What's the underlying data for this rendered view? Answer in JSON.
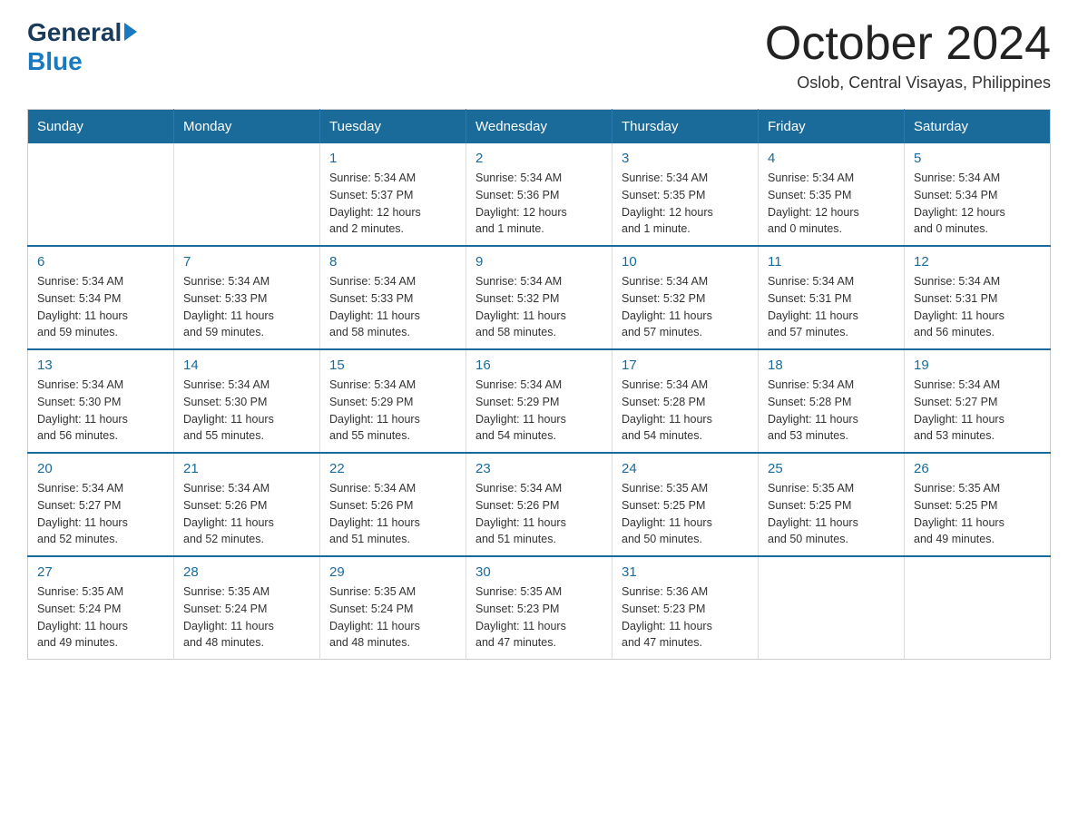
{
  "header": {
    "logo": {
      "general": "General",
      "arrow": "▶",
      "blue": "Blue"
    },
    "title": "October 2024",
    "location": "Oslob, Central Visayas, Philippines"
  },
  "calendar": {
    "days_of_week": [
      "Sunday",
      "Monday",
      "Tuesday",
      "Wednesday",
      "Thursday",
      "Friday",
      "Saturday"
    ],
    "weeks": [
      [
        {
          "day": "",
          "info": ""
        },
        {
          "day": "",
          "info": ""
        },
        {
          "day": "1",
          "info": "Sunrise: 5:34 AM\nSunset: 5:37 PM\nDaylight: 12 hours\nand 2 minutes."
        },
        {
          "day": "2",
          "info": "Sunrise: 5:34 AM\nSunset: 5:36 PM\nDaylight: 12 hours\nand 1 minute."
        },
        {
          "day": "3",
          "info": "Sunrise: 5:34 AM\nSunset: 5:35 PM\nDaylight: 12 hours\nand 1 minute."
        },
        {
          "day": "4",
          "info": "Sunrise: 5:34 AM\nSunset: 5:35 PM\nDaylight: 12 hours\nand 0 minutes."
        },
        {
          "day": "5",
          "info": "Sunrise: 5:34 AM\nSunset: 5:34 PM\nDaylight: 12 hours\nand 0 minutes."
        }
      ],
      [
        {
          "day": "6",
          "info": "Sunrise: 5:34 AM\nSunset: 5:34 PM\nDaylight: 11 hours\nand 59 minutes."
        },
        {
          "day": "7",
          "info": "Sunrise: 5:34 AM\nSunset: 5:33 PM\nDaylight: 11 hours\nand 59 minutes."
        },
        {
          "day": "8",
          "info": "Sunrise: 5:34 AM\nSunset: 5:33 PM\nDaylight: 11 hours\nand 58 minutes."
        },
        {
          "day": "9",
          "info": "Sunrise: 5:34 AM\nSunset: 5:32 PM\nDaylight: 11 hours\nand 58 minutes."
        },
        {
          "day": "10",
          "info": "Sunrise: 5:34 AM\nSunset: 5:32 PM\nDaylight: 11 hours\nand 57 minutes."
        },
        {
          "day": "11",
          "info": "Sunrise: 5:34 AM\nSunset: 5:31 PM\nDaylight: 11 hours\nand 57 minutes."
        },
        {
          "day": "12",
          "info": "Sunrise: 5:34 AM\nSunset: 5:31 PM\nDaylight: 11 hours\nand 56 minutes."
        }
      ],
      [
        {
          "day": "13",
          "info": "Sunrise: 5:34 AM\nSunset: 5:30 PM\nDaylight: 11 hours\nand 56 minutes."
        },
        {
          "day": "14",
          "info": "Sunrise: 5:34 AM\nSunset: 5:30 PM\nDaylight: 11 hours\nand 55 minutes."
        },
        {
          "day": "15",
          "info": "Sunrise: 5:34 AM\nSunset: 5:29 PM\nDaylight: 11 hours\nand 55 minutes."
        },
        {
          "day": "16",
          "info": "Sunrise: 5:34 AM\nSunset: 5:29 PM\nDaylight: 11 hours\nand 54 minutes."
        },
        {
          "day": "17",
          "info": "Sunrise: 5:34 AM\nSunset: 5:28 PM\nDaylight: 11 hours\nand 54 minutes."
        },
        {
          "day": "18",
          "info": "Sunrise: 5:34 AM\nSunset: 5:28 PM\nDaylight: 11 hours\nand 53 minutes."
        },
        {
          "day": "19",
          "info": "Sunrise: 5:34 AM\nSunset: 5:27 PM\nDaylight: 11 hours\nand 53 minutes."
        }
      ],
      [
        {
          "day": "20",
          "info": "Sunrise: 5:34 AM\nSunset: 5:27 PM\nDaylight: 11 hours\nand 52 minutes."
        },
        {
          "day": "21",
          "info": "Sunrise: 5:34 AM\nSunset: 5:26 PM\nDaylight: 11 hours\nand 52 minutes."
        },
        {
          "day": "22",
          "info": "Sunrise: 5:34 AM\nSunset: 5:26 PM\nDaylight: 11 hours\nand 51 minutes."
        },
        {
          "day": "23",
          "info": "Sunrise: 5:34 AM\nSunset: 5:26 PM\nDaylight: 11 hours\nand 51 minutes."
        },
        {
          "day": "24",
          "info": "Sunrise: 5:35 AM\nSunset: 5:25 PM\nDaylight: 11 hours\nand 50 minutes."
        },
        {
          "day": "25",
          "info": "Sunrise: 5:35 AM\nSunset: 5:25 PM\nDaylight: 11 hours\nand 50 minutes."
        },
        {
          "day": "26",
          "info": "Sunrise: 5:35 AM\nSunset: 5:25 PM\nDaylight: 11 hours\nand 49 minutes."
        }
      ],
      [
        {
          "day": "27",
          "info": "Sunrise: 5:35 AM\nSunset: 5:24 PM\nDaylight: 11 hours\nand 49 minutes."
        },
        {
          "day": "28",
          "info": "Sunrise: 5:35 AM\nSunset: 5:24 PM\nDaylight: 11 hours\nand 48 minutes."
        },
        {
          "day": "29",
          "info": "Sunrise: 5:35 AM\nSunset: 5:24 PM\nDaylight: 11 hours\nand 48 minutes."
        },
        {
          "day": "30",
          "info": "Sunrise: 5:35 AM\nSunset: 5:23 PM\nDaylight: 11 hours\nand 47 minutes."
        },
        {
          "day": "31",
          "info": "Sunrise: 5:36 AM\nSunset: 5:23 PM\nDaylight: 11 hours\nand 47 minutes."
        },
        {
          "day": "",
          "info": ""
        },
        {
          "day": "",
          "info": ""
        }
      ]
    ]
  }
}
